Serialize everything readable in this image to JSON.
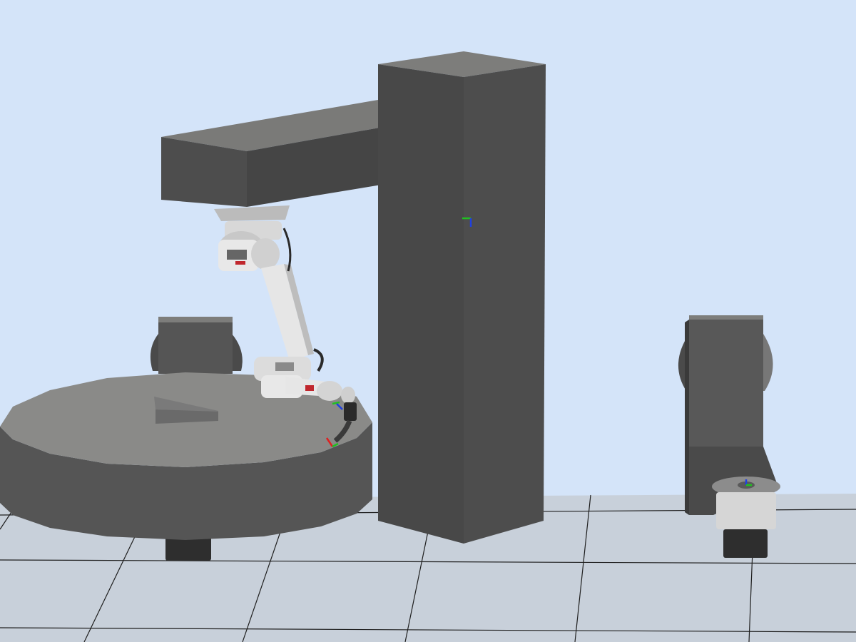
{
  "viewport": {
    "background_color": "#d4e4f9",
    "floor_color": "#c8d0da",
    "grid_line_color": "#1e1e1e"
  },
  "scene_objects": {
    "gantry": {
      "color": "#4b4b4b",
      "top_color": "#7d7d7b"
    },
    "turntable_positioner": {
      "color": "#555555",
      "top_color": "#8a8a88"
    },
    "workpiece_plate": {
      "color": "#6a6a6a"
    },
    "robot_arm": {
      "body_color": "#e6e6e6",
      "accent_color": "#c0272d"
    },
    "headstock_positioner": {
      "color": "#4a4a4a",
      "flange_color": "#777777"
    }
  },
  "frame_axes": {
    "x_color": "#e02020",
    "y_color": "#20c020",
    "z_color": "#2040e0"
  }
}
